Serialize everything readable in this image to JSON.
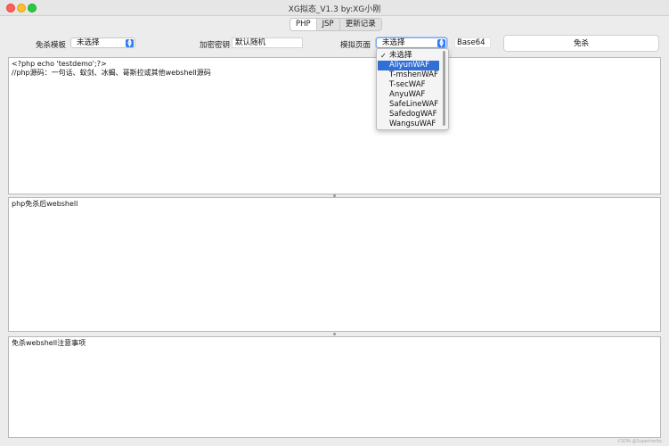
{
  "window": {
    "title": "XG拟态_V1.3  by:XG小刚"
  },
  "tabs": [
    {
      "label": "PHP",
      "active": true
    },
    {
      "label": "JSP",
      "active": false
    },
    {
      "label": "更新记录",
      "active": false
    }
  ],
  "controls": {
    "template_label": "免杀模板",
    "template_value": "未选择",
    "key_label": "加密密钥",
    "key_value": "默认随机",
    "page_label": "模拟页面",
    "page_value": "未选择",
    "base64_label": "Base64",
    "action_button": "免杀"
  },
  "dropdown": {
    "options": [
      "未选择",
      "AliyunWAF",
      "T-mshenWAF",
      "T-secWAF",
      "AnyuWAF",
      "SafeLineWAF",
      "SafedogWAF",
      "WangsuWAF"
    ],
    "checked_index": 0,
    "highlighted_index": 1
  },
  "panes": {
    "source_text": "<?php echo 'testdemo';?>\n//php源码：一句话、蚁剑、冰蝎、哥斯拉或其他webshell源码",
    "result_text": "php免杀后webshell",
    "notes_text": "免杀webshell注意事项"
  },
  "watermark": "CSDN @Superherbs"
}
